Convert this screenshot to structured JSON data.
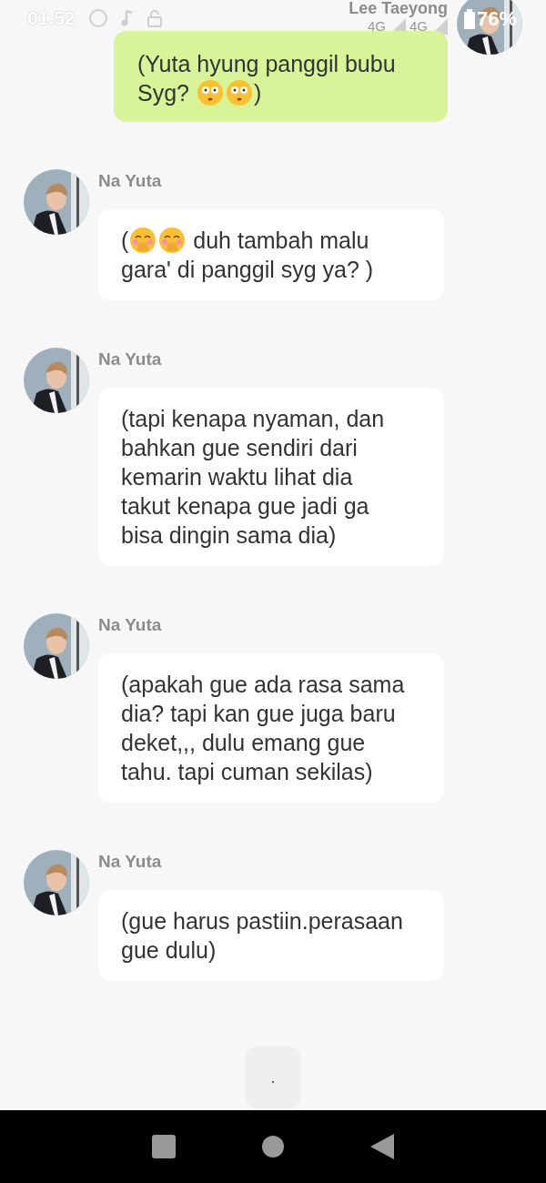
{
  "status_bar": {
    "time": "01.52",
    "network_1": "4G",
    "network_2": "4G",
    "battery": "76%"
  },
  "outgoing": {
    "sender": "Lee Taeyong",
    "parts": [
      {
        "kind": "text",
        "text": "(Yuta hyung panggil bubu Syg? "
      },
      {
        "kind": "flushed"
      },
      {
        "kind": "flushed"
      },
      {
        "kind": "text",
        "text": ")"
      }
    ]
  },
  "messages": [
    {
      "sender": "Na Yuta",
      "parts": [
        {
          "kind": "text",
          "text": "("
        },
        {
          "kind": "shy"
        },
        {
          "kind": "shy"
        },
        {
          "kind": "text",
          "text": " duh tambah malu gara' di panggil syg ya? )"
        }
      ]
    },
    {
      "sender": "Na Yuta",
      "parts": [
        {
          "kind": "text",
          "text": "(tapi kenapa nyaman, dan bahkan gue sendiri dari kemarin waktu lihat dia takut kenapa gue jadi ga bisa dingin sama dia)"
        }
      ]
    },
    {
      "sender": "Na Yuta",
      "parts": [
        {
          "kind": "text",
          "text": "(apakah gue ada rasa sama dia? tapi kan gue juga baru deket,,, dulu emang gue tahu. tapi cuman sekilas)"
        }
      ]
    },
    {
      "sender": "Na Yuta",
      "parts": [
        {
          "kind": "text",
          "text": "(gue harus pastiin.perasaan gue dulu)"
        }
      ]
    }
  ],
  "typing_indicator": {
    "text": "."
  }
}
